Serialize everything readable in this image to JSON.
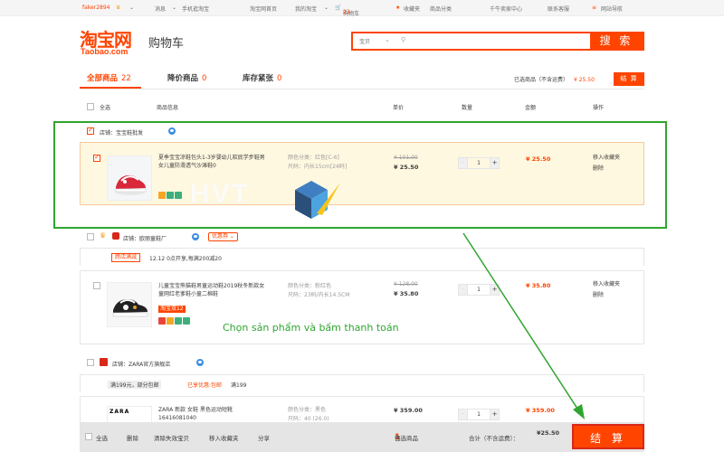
{
  "topbar": {
    "username": "faker2894",
    "messages": "消息",
    "mobile": "手机逛淘宝",
    "home": "淘宝网首页",
    "my_taobao": "我的淘宝",
    "cart": "购物车",
    "cart_count": "22",
    "favorites": "收藏夹",
    "categories": "商品分类",
    "seller_center": "千牛卖家中心",
    "contact": "联系客服",
    "site_nav": "网站导航"
  },
  "header": {
    "logo_cn": "淘宝网",
    "logo_en": "Taobao.com",
    "page_title": "购物车",
    "search_category": "宝贝",
    "search_button": "搜 索"
  },
  "tabs": [
    {
      "label": "全部商品",
      "count": "22"
    },
    {
      "label": "降价商品",
      "count": "0"
    },
    {
      "label": "库存紧张",
      "count": "0"
    }
  ],
  "summary_top": {
    "selected_label": "已选商品（不含运费）",
    "price": "¥ 25.50",
    "checkout": "结 算"
  },
  "columns": {
    "select_all": "全选",
    "info": "商品信息",
    "unit_price": "单价",
    "quantity": "数量",
    "amount": "金额",
    "operation": "操作"
  },
  "shops": [
    {
      "name": "店铺：宝宝鞋批发",
      "items": [
        {
          "title": "夏季宝宝凉鞋包头1-3岁婴幼儿软底学步鞋男女儿童防滑透气沙滩鞋0",
          "sku_color": "颜色分类：红色[C-6]",
          "sku_size": "尺码：内长15cm[24码]",
          "old_price": "¥ 101.00",
          "price": "¥ 25.50",
          "qty": "1",
          "amount": "¥ 25.50",
          "op_fav": "移入收藏夹",
          "op_delete": "删除"
        }
      ]
    },
    {
      "name": "店铺：欧丽童鞋厂",
      "coupon": "优惠券",
      "promo_tag": "跨店满减",
      "promo_text": "12.12 0点开享,每满200减20",
      "items": [
        {
          "title": "儿童宝宝熊猫鞋男童运动鞋2019秋冬新款女童网红老爹鞋小童二棉鞋",
          "sku_color": "颜色分类：粉红色",
          "sku_size": "尺码：23码/内长14.5CM",
          "badge": "淘宝双12",
          "old_price": "¥ 128.00",
          "price": "¥ 35.80",
          "qty": "1",
          "amount": "¥ 35.80",
          "op_fav": "移入收藏夹",
          "op_delete": "删除"
        }
      ]
    },
    {
      "name": "店铺：ZARA官方旗舰店",
      "promo_text": "满199元，部分包邮",
      "promo_tag": "已享优惠:包邮",
      "promo_extra": "满199",
      "items": [
        {
          "title": "ZARA 新款 女鞋 黑色运动短靴 16416081040",
          "thumb_text": "ZARA",
          "sku_color": "颜色分类：黑色",
          "sku_size": "尺码：40 (26.0)",
          "price": "¥ 359.00",
          "qty": "1",
          "amount": "¥ 359.00"
        }
      ]
    }
  ],
  "annotation": "Chọn sản phẩm và bấm thanh toán",
  "watermark": "HVT",
  "bottom": {
    "select_all": "全选",
    "delete": "删除",
    "clear_invalid": "清除失效宝贝",
    "move_fav": "移入收藏夹",
    "share": "分享",
    "selected_label": "已选商品",
    "selected_count": "1",
    "unit": "件",
    "total_label": "合计（不含运费）：",
    "total": "¥25.50",
    "checkout": "结 算"
  },
  "colors": {
    "accent": "#ff4400",
    "annotation": "#2fa52f",
    "selected_row": "#fff8e1"
  }
}
